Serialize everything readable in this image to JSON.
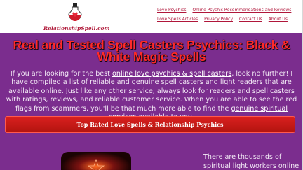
{
  "logo": {
    "text": "RelationshipSpell.com"
  },
  "nav": [
    "Love Psychics",
    "Online Psychic Recommendations and Reviews",
    "Love Spells Articles",
    "Privacy Policy",
    "Contact Us",
    "About Us"
  ],
  "hero": {
    "title": "Real and Tested Spell Casters Psychics: Black & White Magic Spells"
  },
  "intro": {
    "p1": "If you are looking for the best ",
    "link1": "online love psychics &  spell casters",
    "p2": ", look no further! I have compiled a list of reliable and genuine spell casters and light readers that are available online. Just like any other service, always look for readers and spell casters with ratings, reviews, and reliable customer service. When you are able to see the red flags from scammers, you'll be that much more able to find the ",
    "link2": "genuine spiritual services",
    "p3": " available to you."
  },
  "cta": {
    "label": "Top Rated Love Spells & Relationship Psychics"
  },
  "side": {
    "text": "There are thousands of spiritual light workers online"
  },
  "colors": {
    "background": "#7b2d8e",
    "title": "#ff2a2a",
    "button": "#c8191a",
    "nav_link": "#b0163a"
  }
}
